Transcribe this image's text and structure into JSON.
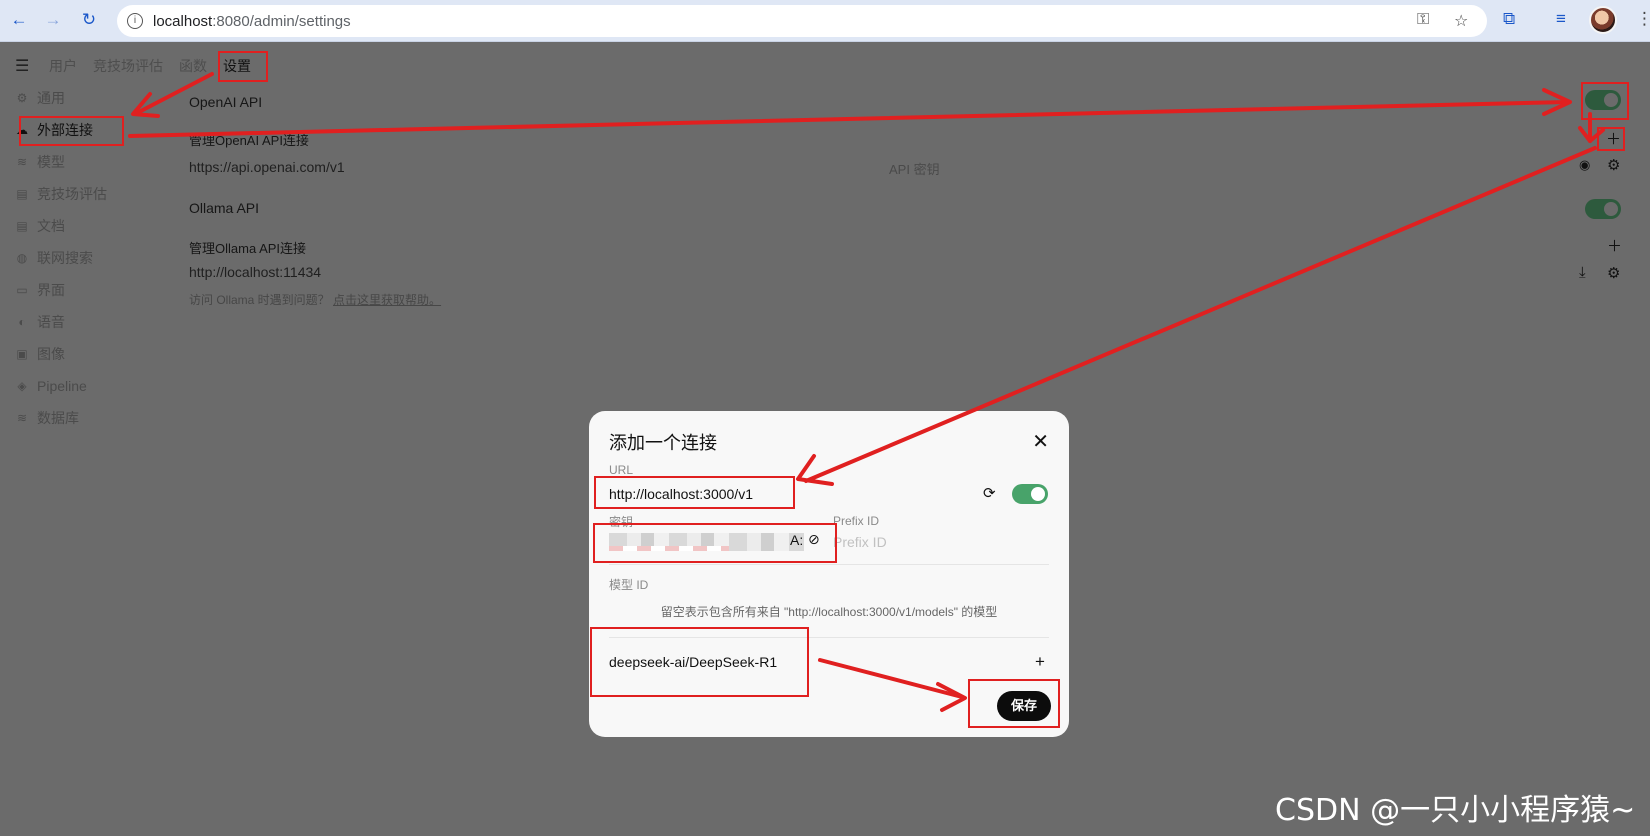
{
  "browser": {
    "url_host": "localhost",
    "url_rest": ":8080/admin/settings"
  },
  "tabs": [
    "用户",
    "竞技场评估",
    "函数",
    "设置"
  ],
  "sidebar": [
    {
      "label": "通用",
      "icon": "gear-icon"
    },
    {
      "label": "外部连接",
      "icon": "cloud-icon"
    },
    {
      "label": "模型",
      "icon": "database-icon"
    },
    {
      "label": "竞技场评估",
      "icon": "document-icon"
    },
    {
      "label": "文档",
      "icon": "document-icon"
    },
    {
      "label": "联网搜索",
      "icon": "globe-icon"
    },
    {
      "label": "界面",
      "icon": "monitor-icon"
    },
    {
      "label": "语音",
      "icon": "speaker-icon"
    },
    {
      "label": "图像",
      "icon": "image-icon"
    },
    {
      "label": "Pipeline",
      "icon": "layers-icon"
    },
    {
      "label": "数据库",
      "icon": "database-icon"
    }
  ],
  "settings": {
    "openai_title": "OpenAI API",
    "openai_manage": "管理OpenAI API连接",
    "openai_url": "https://api.openai.com/v1",
    "openai_key_label": "API 密钥",
    "ollama_title": "Ollama API",
    "ollama_manage": "管理Ollama API连接",
    "ollama_url": "http://localhost:11434",
    "ollama_help": "访问 Ollama 时遇到问题？",
    "ollama_help_link": "点击这里获取帮助。"
  },
  "modal": {
    "title": "添加一个连接",
    "url_label": "URL",
    "url_value": "http://localhost:3000/v1",
    "key_label": "密钥",
    "key_suffix": "A:",
    "prefix_label": "Prefix ID",
    "prefix_placeholder": "Prefix ID",
    "model_label": "模型 ID",
    "model_hint": "留空表示包含所有来自 \"http://localhost:3000/v1/models\" 的模型",
    "model_value": "deepseek-ai/DeepSeek-R1",
    "save_label": "保存"
  },
  "watermark": "CSDN @一只小小程序猿~",
  "colors": {
    "annotation_red": "#e02020",
    "toggle_on": "#48a36a",
    "save_button": "#0c0c0c"
  }
}
